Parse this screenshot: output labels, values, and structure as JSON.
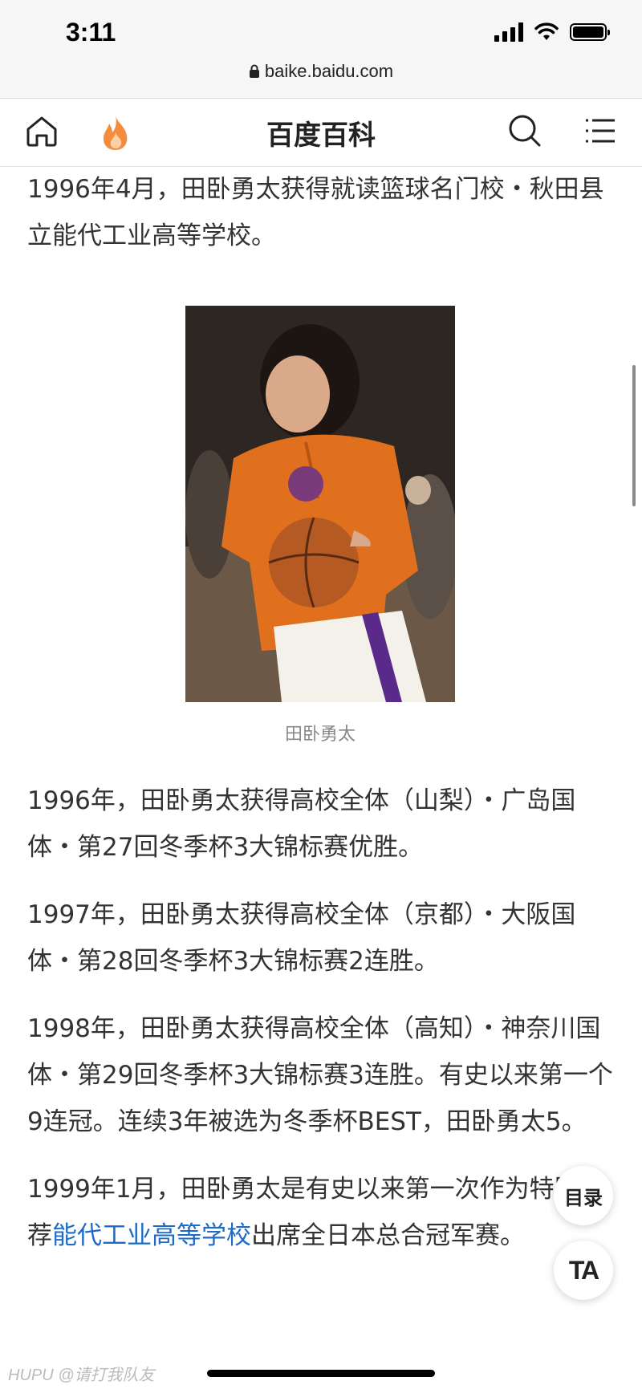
{
  "status_bar": {
    "time": "3:11"
  },
  "browser": {
    "url": "baike.baidu.com"
  },
  "nav": {
    "title": "百度百科"
  },
  "content": {
    "para_1": "1996年4月，田卧勇太获得就读篮球名门校・秋田县立能代工业高等学校。",
    "figure_caption": "田卧勇太",
    "para_2": "1996年，田卧勇太获得高校全体（山梨）・广岛国体・第27回冬季杯3大锦标赛优胜。",
    "para_3": "1997年，田卧勇太获得高校全体（京都）・大阪国体・第28回冬季杯3大锦标赛2连胜。",
    "para_4": "1998年，田卧勇太获得高校全体（高知）・神奈川国体・第29回冬季杯3大锦标赛3连胜。有史以来第一个9连冠。连续3年被选为冬季杯BEST，田卧勇太5。",
    "para_5": {
      "before": "1999年1月，田卧勇太是有史以来第一次作为特别推荐",
      "link": "能代工业高等学校",
      "after": "出席全日本总合冠军赛。"
    }
  },
  "floating": {
    "toc_label": "目录",
    "ta_label": "TA"
  },
  "watermark": "HUPU @请打我队友",
  "colors": {
    "link": "#1e6bc7",
    "hot_icon": "#f58b3c"
  }
}
